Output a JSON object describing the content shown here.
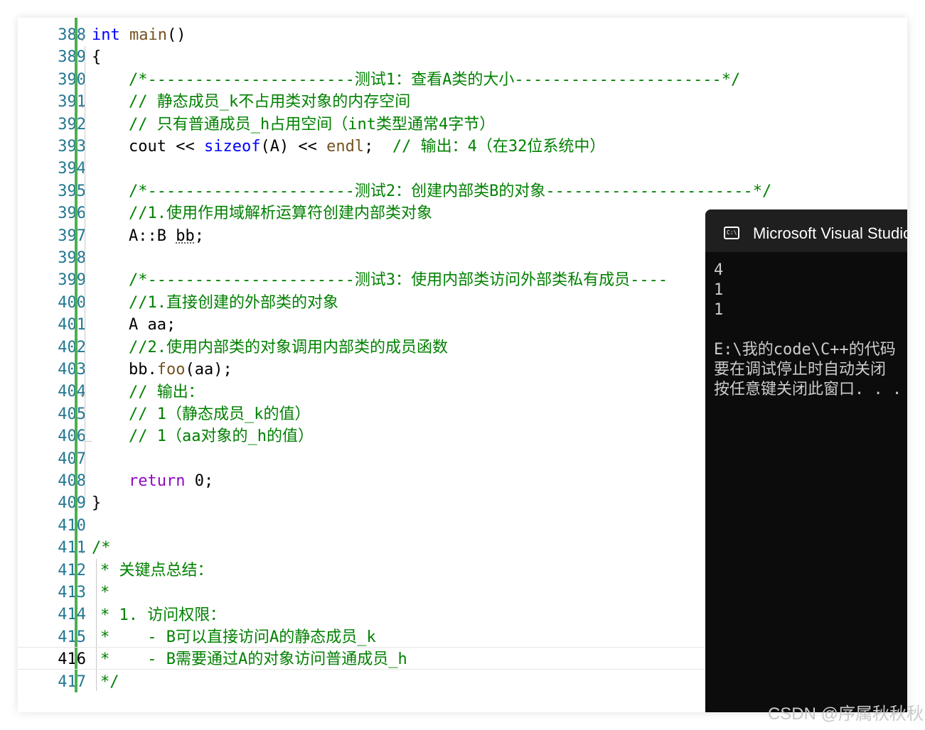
{
  "editor": {
    "line_numbers": [
      "388",
      "389",
      "390",
      "391",
      "392",
      "393",
      "394",
      "395",
      "396",
      "397",
      "398",
      "399",
      "400",
      "401",
      "402",
      "403",
      "404",
      "405",
      "406",
      "407",
      "408",
      "409",
      "410",
      "411",
      "412",
      "413",
      "414",
      "415",
      "416",
      "417"
    ],
    "current_line": "416",
    "lines": {
      "l388": {
        "kw": "int",
        "fn": "main",
        "rest": "()"
      },
      "l389": "{",
      "l390": "/*----------------------测试1：查看A类的大小----------------------*/",
      "l391": "// 静态成员_k不占用类对象的内存空间",
      "l392": "// 只有普通成员_h占用空间（int类型通常4字节）",
      "l393": {
        "a": "cout << ",
        "kw": "sizeof",
        "b": "(A) << ",
        "fn": "endl",
        "c": ";  ",
        "cm": "// 输出：4（在32位系统中）"
      },
      "l395": "/*----------------------测试2：创建内部类B的对象----------------------*/",
      "l396": "//1.使用作用域解析运算符创建内部类对象",
      "l397": {
        "a": "A::B ",
        "b": "bb",
        "c": ";"
      },
      "l399": "/*----------------------测试3：使用内部类访问外部类私有成员----",
      "l400": "//1.直接创建的外部类的对象",
      "l401": "A aa;",
      "l402": "//2.使用内部类的对象调用内部类的成员函数",
      "l403": {
        "a": "bb.",
        "fn": "foo",
        "b": "(aa);"
      },
      "l404": "// 输出：",
      "l405": "// 1（静态成员_k的值）",
      "l406": "// 1（aa对象的_h的值）",
      "l408": {
        "ret": "return",
        "b": " 0;"
      },
      "l409": "}",
      "l411": "/*",
      "l412": "* 关键点总结：",
      "l413": "*",
      "l414": "* 1. 访问权限：",
      "l415": "*    - B可以直接访问A的静态成员_k",
      "l416": "*    - B需要通过A的对象访问普通成员_h",
      "l417": "*/"
    }
  },
  "console": {
    "title": "Microsoft Visual Studio",
    "icon": "console-icon",
    "icon_text": "C:\\",
    "output": "4\n1\n1\n\nE:\\我的code\\C++的代码\n要在调试停止时自动关闭\n按任意键关闭此窗口. . ."
  },
  "watermark": "CSDN @序属秋秋秋"
}
